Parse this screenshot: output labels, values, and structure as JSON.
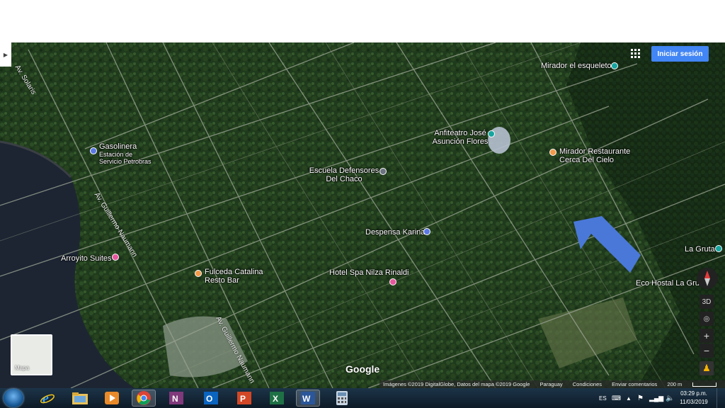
{
  "header": {
    "signin_label": "Iniciar sesión",
    "apps_icon": "apps-grid-icon",
    "expand_icon": "chevron-right-icon"
  },
  "map": {
    "places": [
      {
        "id": "mirador-esqueleto",
        "name": "Mirador el esqueleto",
        "pin_color": "#16a5a0"
      },
      {
        "id": "anfiteatro",
        "name": "Anfiteatro José\nAsunción Flores",
        "pin_color": "#16a5a0"
      },
      {
        "id": "mirador-restaurante",
        "name": "Mirador Restaurante\nCerca Del Cielo",
        "pin_color": "#f29a4a"
      },
      {
        "id": "gasolinera",
        "name": "Gasolinera",
        "pin_color": "#5b78e4"
      },
      {
        "id": "estacion",
        "name": "Estación de\nServicio Petrobras"
      },
      {
        "id": "escuela",
        "name": "Escuela Defensores\nDel Chaco",
        "pin_color": "#6b7280"
      },
      {
        "id": "despensa",
        "name": "Despensa Karina",
        "pin_color": "#5b78e4"
      },
      {
        "id": "la-gruta",
        "name": "La Gruta",
        "pin_color": "#16a5a0"
      },
      {
        "id": "eco-hostal",
        "name": "Eco Hostal La Gruta"
      },
      {
        "id": "arroyito",
        "name": "Arroyito Suites",
        "pin_color": "#e7579c"
      },
      {
        "id": "fulceda",
        "name": "Fulceda Catalina\nResto Bar",
        "pin_color": "#f29a4a"
      },
      {
        "id": "hotel-spa",
        "name": "Hotel Spa Nilza Rinaldi",
        "pin_color": "#e7579c"
      }
    ],
    "roads": {
      "r1": "Av. Guillermo Naumann",
      "r2": "Av. Guillermo Naumann",
      "r3": "Av. Solaris"
    },
    "arrow_color": "#4a78d8",
    "layer_switch_label": "Mapa",
    "controls": {
      "tilt_label": "3D",
      "zoom_in": "+",
      "zoom_out": "−",
      "compass_icon": "compass-icon",
      "pegman_icon": "pegman-icon",
      "location_icon": "my-location-icon"
    },
    "logo": "Google",
    "footer": {
      "imagery": "Imágenes ©2019 DigitalGlobe, Datos del mapa ©2019 Google",
      "country": "Paraguay",
      "terms": "Condiciones",
      "feedback": "Enviar comentarios",
      "scale": "200 m"
    }
  },
  "taskbar": {
    "apps": [
      "start-icon",
      "ie-icon",
      "explorer-icon",
      "media-icon",
      "chrome-icon",
      "onenote-icon",
      "outlook-icon",
      "powerpoint-icon",
      "excel-icon",
      "word-icon",
      "calculator-icon"
    ],
    "lang": "ES",
    "time": "03:29 p.m.",
    "date": "11/03/2019"
  }
}
